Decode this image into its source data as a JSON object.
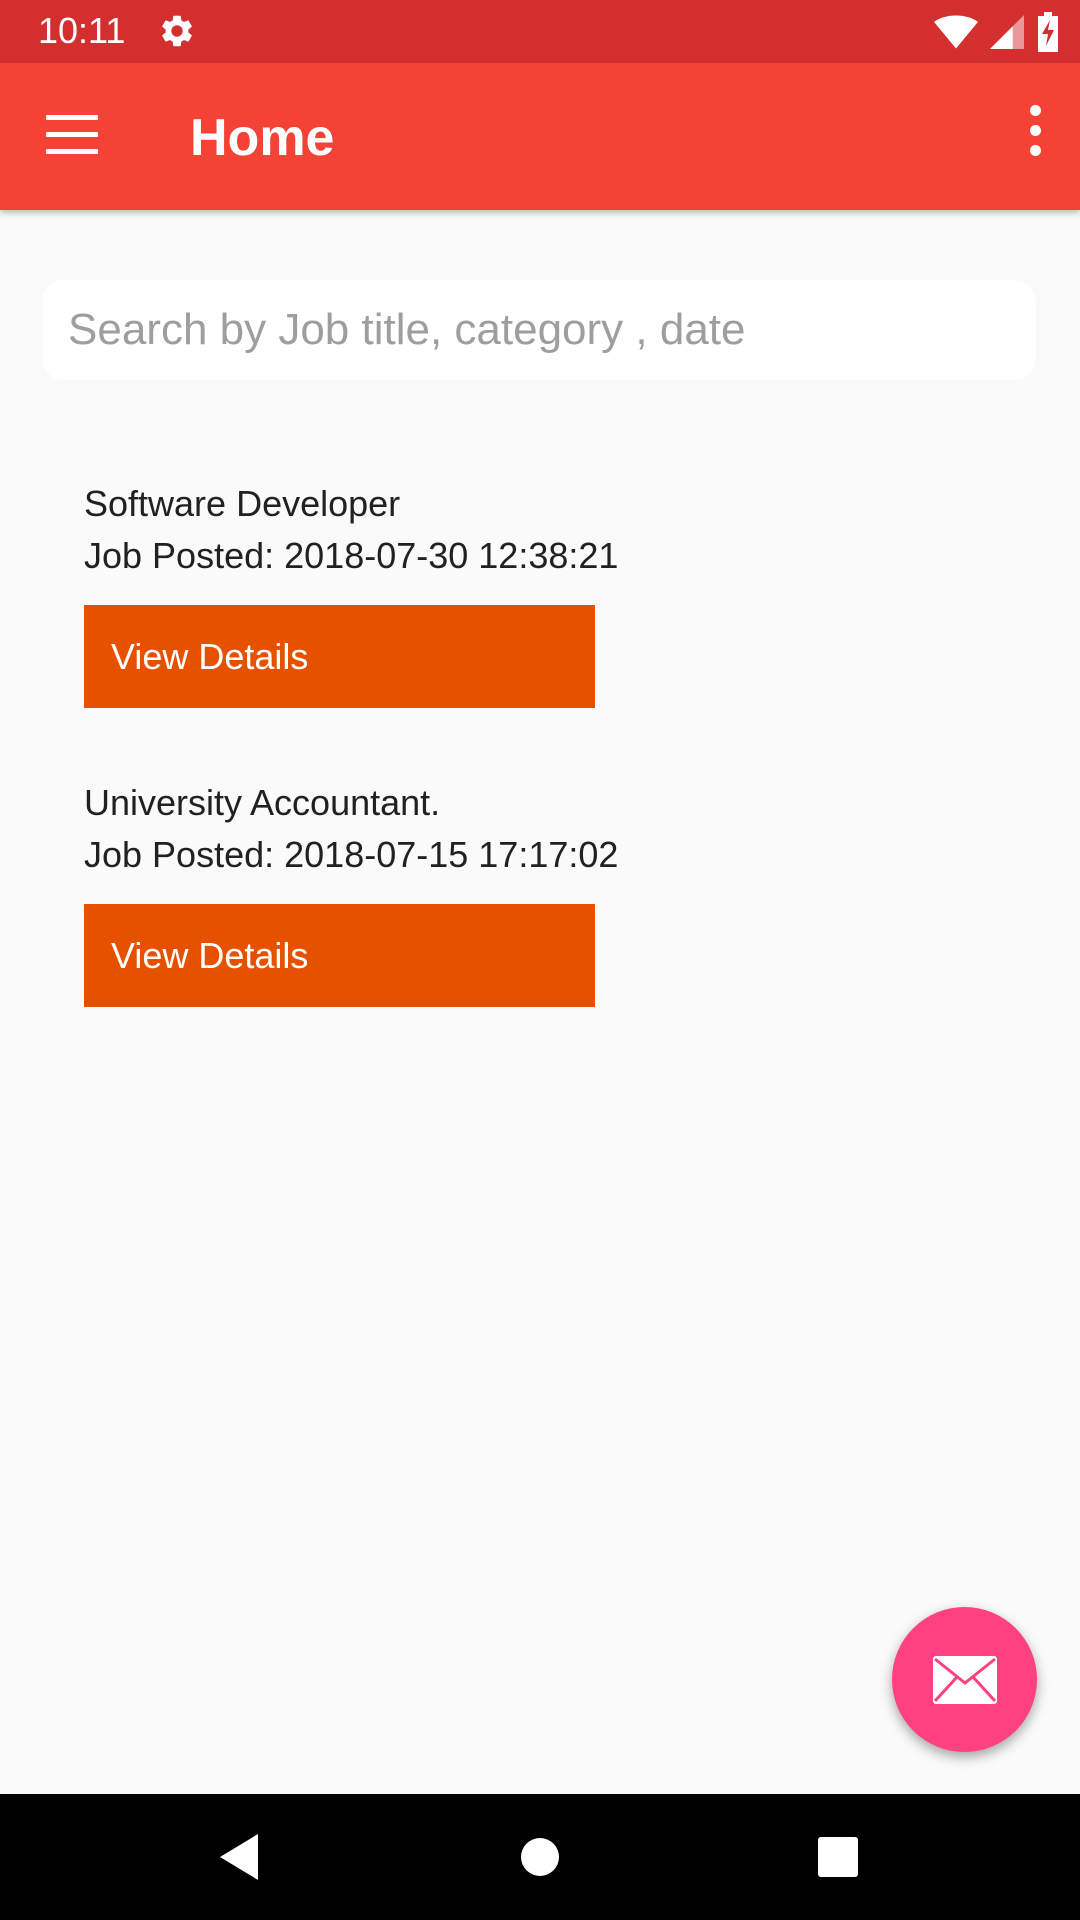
{
  "status_bar": {
    "time": "10:11",
    "icons": [
      "gear-icon",
      "wifi-icon",
      "signal-icon",
      "battery-charging-icon"
    ]
  },
  "app_bar": {
    "title": "Home",
    "menu_icon": "hamburger-menu-icon",
    "overflow_icon": "more-vert-icon"
  },
  "search": {
    "placeholder": "Search by Job title, category , date",
    "value": ""
  },
  "jobs": [
    {
      "title": "Software Developer",
      "posted": "Job Posted: 2018-07-30 12:38:21",
      "button_label": "View Details"
    },
    {
      "title": "University Accountant.",
      "posted": "Job Posted: 2018-07-15 17:17:02",
      "button_label": "View Details"
    }
  ],
  "fab": {
    "icon": "mail-icon"
  },
  "nav_bar": {
    "icons": [
      "back-icon",
      "home-icon",
      "recents-icon"
    ]
  },
  "colors": {
    "status_bar": "#d32f2f",
    "app_bar": "#f44336",
    "button": "#e65100",
    "fab": "#ff4081",
    "background": "#fafafa"
  }
}
